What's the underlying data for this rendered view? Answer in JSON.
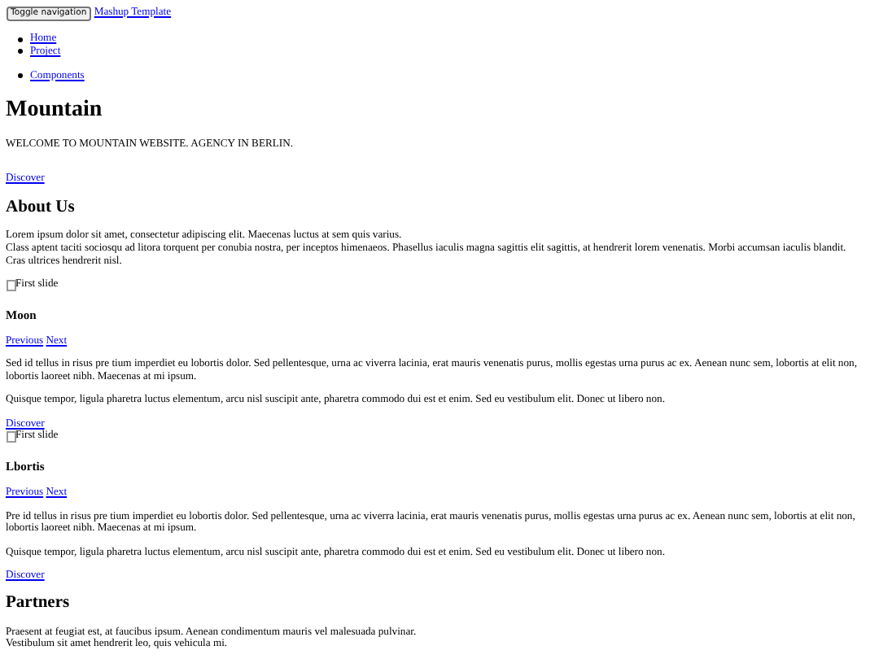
{
  "navbar": {
    "toggle_button": "Toggle navigation",
    "brand": "Mashup Template",
    "menu_items": [
      "Home",
      "Project"
    ],
    "dropdown_items": [
      "Components"
    ]
  },
  "hero": {
    "title": "Mountain",
    "subtitle": "WELCOME TO MOUNTAIN WEBSITE. AGENCY IN BERLIN.",
    "link": "Discover"
  },
  "about": {
    "title": "About Us",
    "lines": [
      "Lorem ipsum dolor sit amet, consectetur adipiscing elit. Maecenas luctus at sem quis varius.",
      "Class aptent taciti sociosqu ad litora torquent per conubia nostra, per inceptos himenaeos. Phasellus iaculis magna sagittis elit sagittis, at hendrerit lorem venenatis. Morbi accumsan iaculis blandit.",
      "Cras ultrices hendrerit nisl."
    ]
  },
  "slides": [
    {
      "image_alt": "First slide",
      "title": "Moon",
      "previous": "Previous",
      "next": "Next",
      "paragraphs": [
        "Sed id tellus in risus pre tium imperdiet eu lobortis dolor. Sed pellentesque, urna ac viverra lacinia, erat mauris venenatis purus, mollis egestas urna purus ac ex. Aenean nunc sem, lobortis at elit non, lobortis laoreet nibh. Maecenas at mi ipsum.",
        "Quisque tempor, ligula pharetra luctus elementum, arcu nisl suscipit ante, pharetra commodo dui est et enim. Sed eu vestibulum elit. Donec ut libero non."
      ],
      "link": "Discover"
    },
    {
      "image_alt": "First slide",
      "title": "Lbortis",
      "previous": "Previous",
      "next": "Next",
      "paragraphs": [
        "Pre id tellus in risus pre tium imperdiet eu lobortis dolor. Sed pellentesque, urna ac viverra lacinia, erat mauris venenatis purus, mollis egestas urna purus ac ex. Aenean nunc sem, lobortis at elit non, lobortis laoreet nibh. Maecenas at mi ipsum.",
        "Quisque tempor, ligula pharetra luctus elementum, arcu nisl suscipit ante, pharetra commodo dui est et enim. Sed eu vestibulum elit. Donec ut libero non."
      ],
      "link": "Discover"
    }
  ],
  "partners": {
    "title": "Partners",
    "lines": [
      "Praesent at feugiat est, at faucibus ipsum. Aenean condimentum mauris vel malesuada pulvinar.",
      "Vestibulum sit amet hendrerit leo, quis vehicula mi."
    ]
  }
}
